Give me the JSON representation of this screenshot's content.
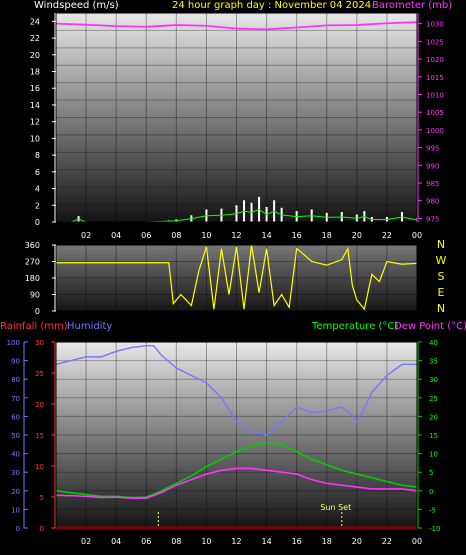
{
  "header": {
    "windspeed_label": "Windspeed (m/s)",
    "title": "24 hour graph day : November 04 2024",
    "barometer_label": "Barometer (mb)",
    "rainfall_label": "Rainfall (mm)",
    "humidity_label": "Humidity",
    "temperature_label": "Temperature (°C)",
    "dewpoint_label": "Dew Point (°C)"
  },
  "colors": {
    "background": "#000000",
    "wind": "#ffffff",
    "wind_avg": "#00ff00",
    "barometer": "#ff33ff",
    "direction": "#ffff00",
    "humidity": "#7777ff",
    "temperature": "#00cc00",
    "dewpoint": "#ff33ff",
    "rain": "#ff0000",
    "title": "#ffff00",
    "temp_label": "#00ff00",
    "left_axis_rain": "#ff3333"
  },
  "x_ticks": [
    "02",
    "04",
    "06",
    "08",
    "10",
    "12",
    "14",
    "16",
    "18",
    "20",
    "22",
    "00"
  ],
  "compass": [
    "N",
    "W",
    "S",
    "E",
    "N"
  ],
  "sunset_label": "Sun Set",
  "chart_data": [
    {
      "type": "line",
      "panel": "wind",
      "title": "24 hour graph day : November 04 2024",
      "left_axis": {
        "label": "Windspeed (m/s)",
        "ticks": [
          "0",
          "2",
          "4",
          "6",
          "8",
          "10",
          "12",
          "14",
          "16",
          "18",
          "20",
          "22",
          "24"
        ],
        "ylim": [
          0,
          25
        ]
      },
      "right_axis": {
        "label": "Barometer (mb)",
        "ticks": [
          "975",
          "980",
          "985",
          "990",
          "995",
          "1000",
          "1005",
          "1010",
          "1015",
          "1020",
          "1025",
          "1030"
        ],
        "ylim": [
          974,
          1033
        ]
      },
      "series": [
        {
          "name": "Windspeed (m/s)",
          "x": [
            0,
            1,
            1.5,
            2,
            4,
            6,
            7.5,
            8,
            9,
            10,
            11,
            12,
            12.5,
            13,
            13.5,
            14,
            14.5,
            15,
            16,
            17,
            18,
            19,
            20,
            20.5,
            21,
            22,
            23,
            24
          ],
          "y": [
            0,
            0,
            0.7,
            0,
            0,
            0,
            0.2,
            0.3,
            0.8,
            1.5,
            1.6,
            2.0,
            2.6,
            2.3,
            3.0,
            1.8,
            2.6,
            1.7,
            1.3,
            1.5,
            1.1,
            1.2,
            0.9,
            1.3,
            0.6,
            0.6,
            1.2,
            0.5
          ]
        },
        {
          "name": "Barometer (mb)",
          "x": [
            0,
            2,
            4,
            6,
            8,
            10,
            12,
            14,
            16,
            18,
            20,
            22,
            24
          ],
          "y": [
            1030.0,
            1029.7,
            1029.3,
            1029.1,
            1029.6,
            1029.4,
            1028.6,
            1028.4,
            1028.9,
            1029.5,
            1029.6,
            1030.1,
            1030.4
          ]
        }
      ]
    },
    {
      "type": "line",
      "panel": "direction",
      "left_axis": {
        "ticks": [
          "0",
          "90",
          "180",
          "270",
          "360"
        ],
        "ylim": [
          0,
          360
        ]
      },
      "series": [
        {
          "name": "Wind direction",
          "x": [
            0,
            7.5,
            7.8,
            8.3,
            9,
            9.5,
            10,
            10.5,
            11,
            11.5,
            12,
            12.5,
            13,
            13.5,
            14,
            14.5,
            15,
            15.5,
            16,
            16.3,
            17,
            18,
            19,
            19.4,
            19.7,
            20,
            20.5,
            21,
            21.5,
            22,
            23,
            24
          ],
          "y": [
            263,
            263,
            40,
            90,
            30,
            220,
            350,
            10,
            340,
            90,
            350,
            10,
            360,
            100,
            340,
            30,
            90,
            20,
            340,
            320,
            270,
            250,
            280,
            340,
            140,
            60,
            10,
            200,
            160,
            270,
            255,
            260
          ]
        }
      ]
    },
    {
      "type": "line",
      "panel": "temperature",
      "left_axis_outer": {
        "label": "Humidity",
        "ticks": [
          "0",
          "10",
          "20",
          "30",
          "40",
          "50",
          "60",
          "70",
          "80",
          "90",
          "100"
        ],
        "ylim": [
          0,
          100
        ]
      },
      "left_axis_inner": {
        "label": "Rainfall (mm)",
        "ticks": [
          "0",
          "5",
          "10",
          "15",
          "20",
          "25",
          "30"
        ],
        "ylim": [
          0,
          30
        ]
      },
      "right_axis": {
        "label": "Temperature (°C)",
        "ticks": [
          "-10",
          "-5",
          "0",
          "5",
          "10",
          "15",
          "20",
          "25",
          "30",
          "35",
          "40"
        ],
        "ylim": [
          -10,
          40
        ]
      },
      "annotation": "Sun Set",
      "series": [
        {
          "name": "Humidity",
          "x": [
            0,
            1,
            2,
            3,
            4,
            5,
            6,
            6.5,
            7,
            8,
            9,
            10,
            11,
            12,
            13,
            14,
            15,
            16,
            17,
            18,
            19,
            19.5,
            20,
            20.3,
            21,
            22,
            23,
            24
          ],
          "y": [
            88,
            90,
            92,
            92,
            95,
            97,
            98,
            98,
            93,
            86,
            82,
            78,
            70,
            57,
            52,
            50,
            57,
            65,
            62,
            63,
            65,
            62,
            57,
            61,
            73,
            82,
            88,
            88
          ]
        },
        {
          "name": "Temperature (°C)",
          "x": [
            0,
            1,
            2,
            3,
            4,
            5,
            6,
            7,
            8,
            9,
            10,
            11,
            12,
            13,
            14,
            15,
            16,
            17,
            18,
            19,
            20,
            21,
            22,
            23,
            24
          ],
          "y": [
            0,
            -0.5,
            -1,
            -1.5,
            -1.5,
            -1.8,
            -1.7,
            0,
            2,
            4,
            6.5,
            8.5,
            10.5,
            12,
            12.8,
            12.5,
            10.5,
            8.5,
            7,
            5.5,
            4.5,
            3.5,
            2.5,
            1.5,
            1
          ]
        },
        {
          "name": "Dew Point (°C)",
          "x": [
            0,
            1,
            2,
            3,
            4,
            5,
            6,
            7,
            8,
            9,
            10,
            11,
            12,
            13,
            14,
            15,
            16,
            17,
            18,
            19,
            20,
            21,
            22,
            23,
            24
          ],
          "y": [
            -1.2,
            -1.3,
            -1.5,
            -1.8,
            -1.7,
            -2,
            -2,
            -0.5,
            1.5,
            3,
            4.5,
            5.5,
            6,
            6,
            5.5,
            5,
            4.5,
            3,
            2,
            1.5,
            1,
            0.5,
            0.5,
            0.5,
            0
          ]
        },
        {
          "name": "Rainfall (mm)",
          "x": [
            0,
            24
          ],
          "y": [
            0,
            0
          ]
        }
      ]
    }
  ]
}
